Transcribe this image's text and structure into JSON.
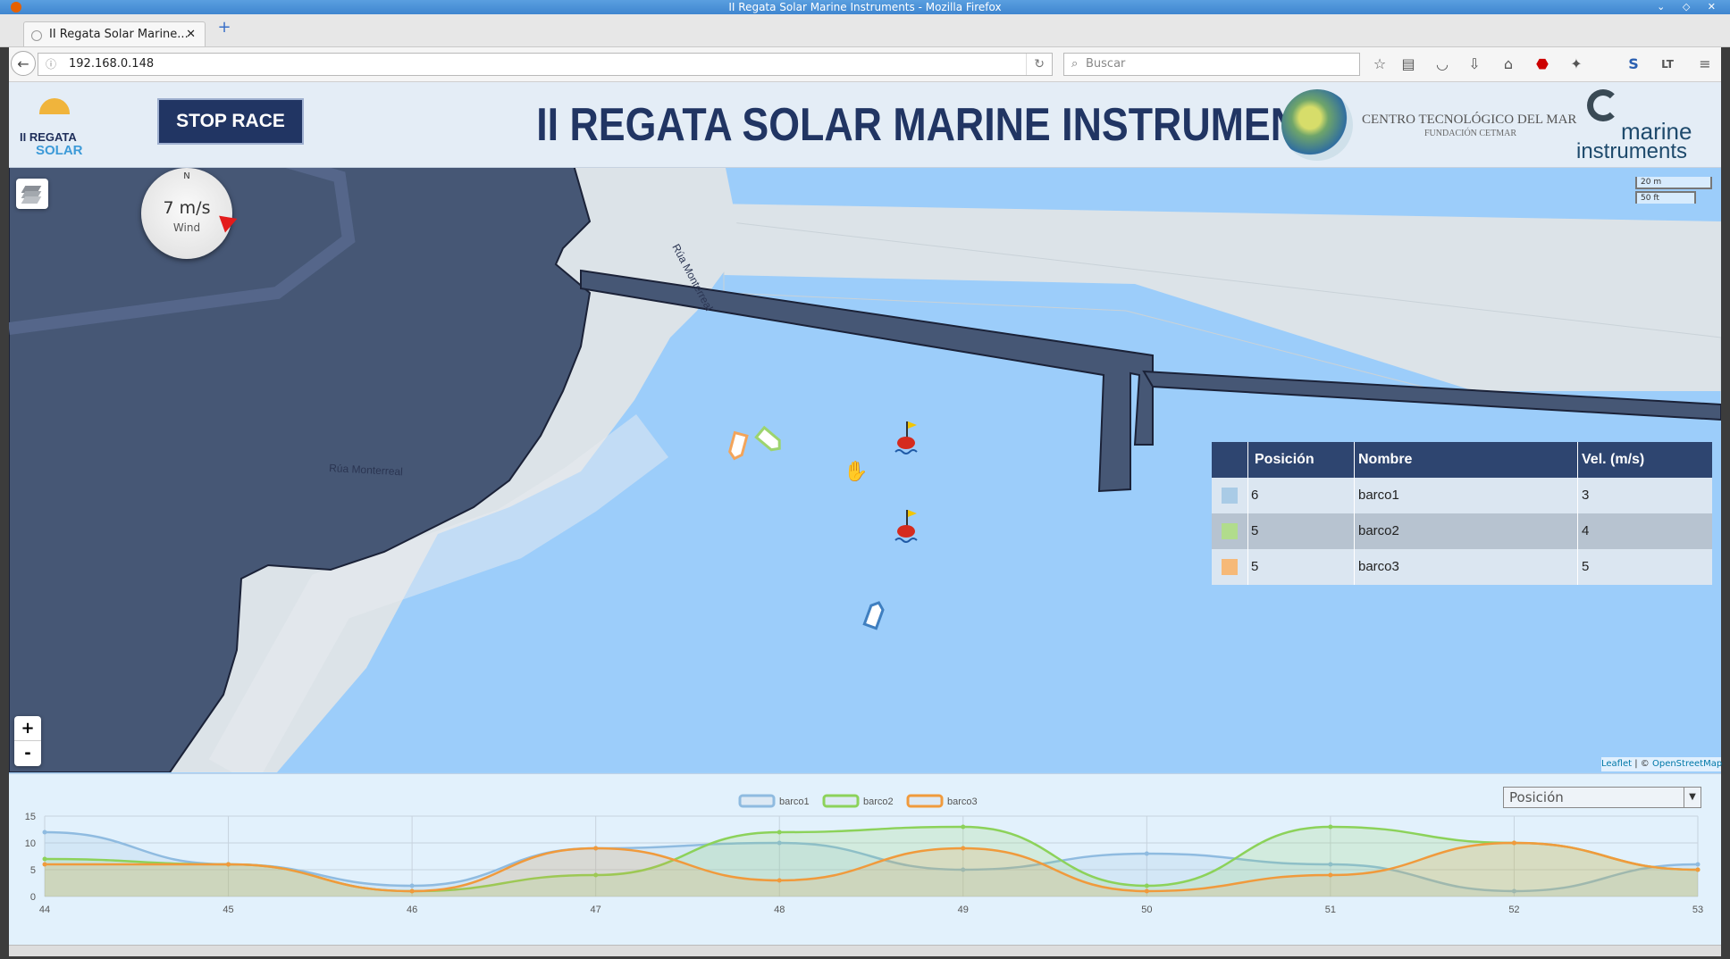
{
  "browser": {
    "window_title": "II Regata Solar Marine Instruments - Mozilla Firefox",
    "tab_title": "II Regata Solar Marine...",
    "url": "192.168.0.148",
    "search_placeholder": "Buscar"
  },
  "header": {
    "logo_line1": "II REGATA",
    "logo_line2": "SOLAR",
    "stop_label": "STOP RACE",
    "title": "II REGATA SOLAR MARINE INSTRUMENTS",
    "partner_name": "CENTRO TECNOLÓGICO DEL MAR",
    "partner_sub": "FUNDACIÓN CETMAR",
    "sponsor_line1": "marine",
    "sponsor_line2": "instruments"
  },
  "map": {
    "compass_n": "N",
    "wind_speed": "7 m/s",
    "wind_label": "Wind",
    "scale_metric": "20 m",
    "scale_imperial": "50 ft",
    "street_labels": [
      "Rúa Monterreal",
      "Rúa Monterreal"
    ],
    "zoom_in": "+",
    "zoom_out": "-",
    "attribution_leaflet": "Leaflet",
    "attribution_sep": " | © ",
    "attribution_osm": "OpenStreetMap",
    "colors": {
      "land": "#465775",
      "shore": "#dce3e8",
      "water": "#9ccdfa"
    }
  },
  "standings": {
    "headers": [
      "Posición",
      "Nombre",
      "Vel. (m/s)"
    ],
    "rows": [
      {
        "pos": "6",
        "name": "barco1",
        "speed": "3",
        "color": "#a9cbe6"
      },
      {
        "pos": "5",
        "name": "barco2",
        "speed": "4",
        "color": "#b1dc8c"
      },
      {
        "pos": "5",
        "name": "barco3",
        "speed": "5",
        "color": "#f6b978"
      }
    ]
  },
  "chart": {
    "metric_selected": "Posición"
  },
  "chart_data": {
    "type": "line",
    "title": "",
    "xlabel": "",
    "ylabel": "",
    "categories": [
      "44",
      "45",
      "46",
      "47",
      "48",
      "49",
      "50",
      "51",
      "52",
      "53"
    ],
    "yticks": [
      "0",
      "5",
      "10",
      "15"
    ],
    "ylim": [
      0,
      15
    ],
    "legend_position": "top-center",
    "grid": true,
    "series": [
      {
        "name": "barco1",
        "color": "#8fbbe0",
        "values": [
          12,
          6,
          2,
          9,
          10,
          5,
          8,
          6,
          1,
          6
        ]
      },
      {
        "name": "barco2",
        "color": "#8cd25a",
        "values": [
          7,
          6,
          1,
          4,
          12,
          13,
          2,
          13,
          10,
          5
        ]
      },
      {
        "name": "barco3",
        "color": "#f09a3c",
        "values": [
          6,
          6,
          1,
          9,
          3,
          9,
          1,
          4,
          10,
          5
        ]
      }
    ]
  }
}
